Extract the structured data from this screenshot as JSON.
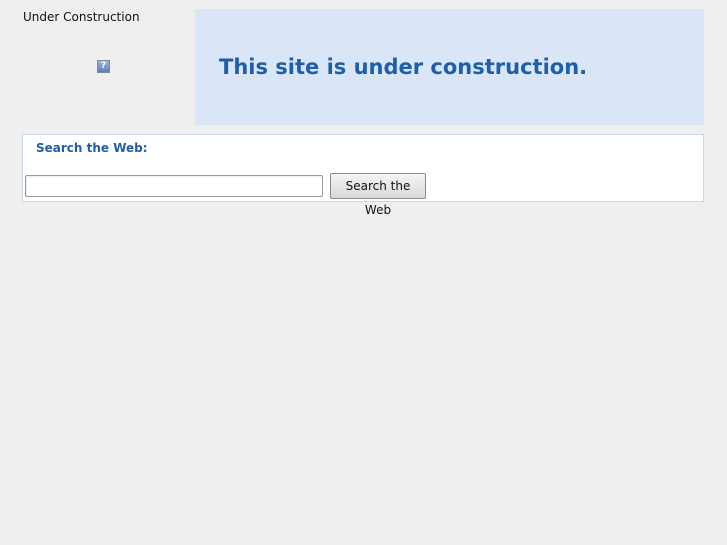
{
  "header": {
    "site_title": "Under Construction",
    "image_placeholder": "?"
  },
  "banner": {
    "message": "This site is under construction."
  },
  "search": {
    "label": "Search the Web:",
    "input_value": "",
    "button_label": "Search the Web"
  },
  "colors": {
    "page_background": "#efefef",
    "banner_background": "#dae6f7",
    "accent_text": "#1f5ea8"
  }
}
